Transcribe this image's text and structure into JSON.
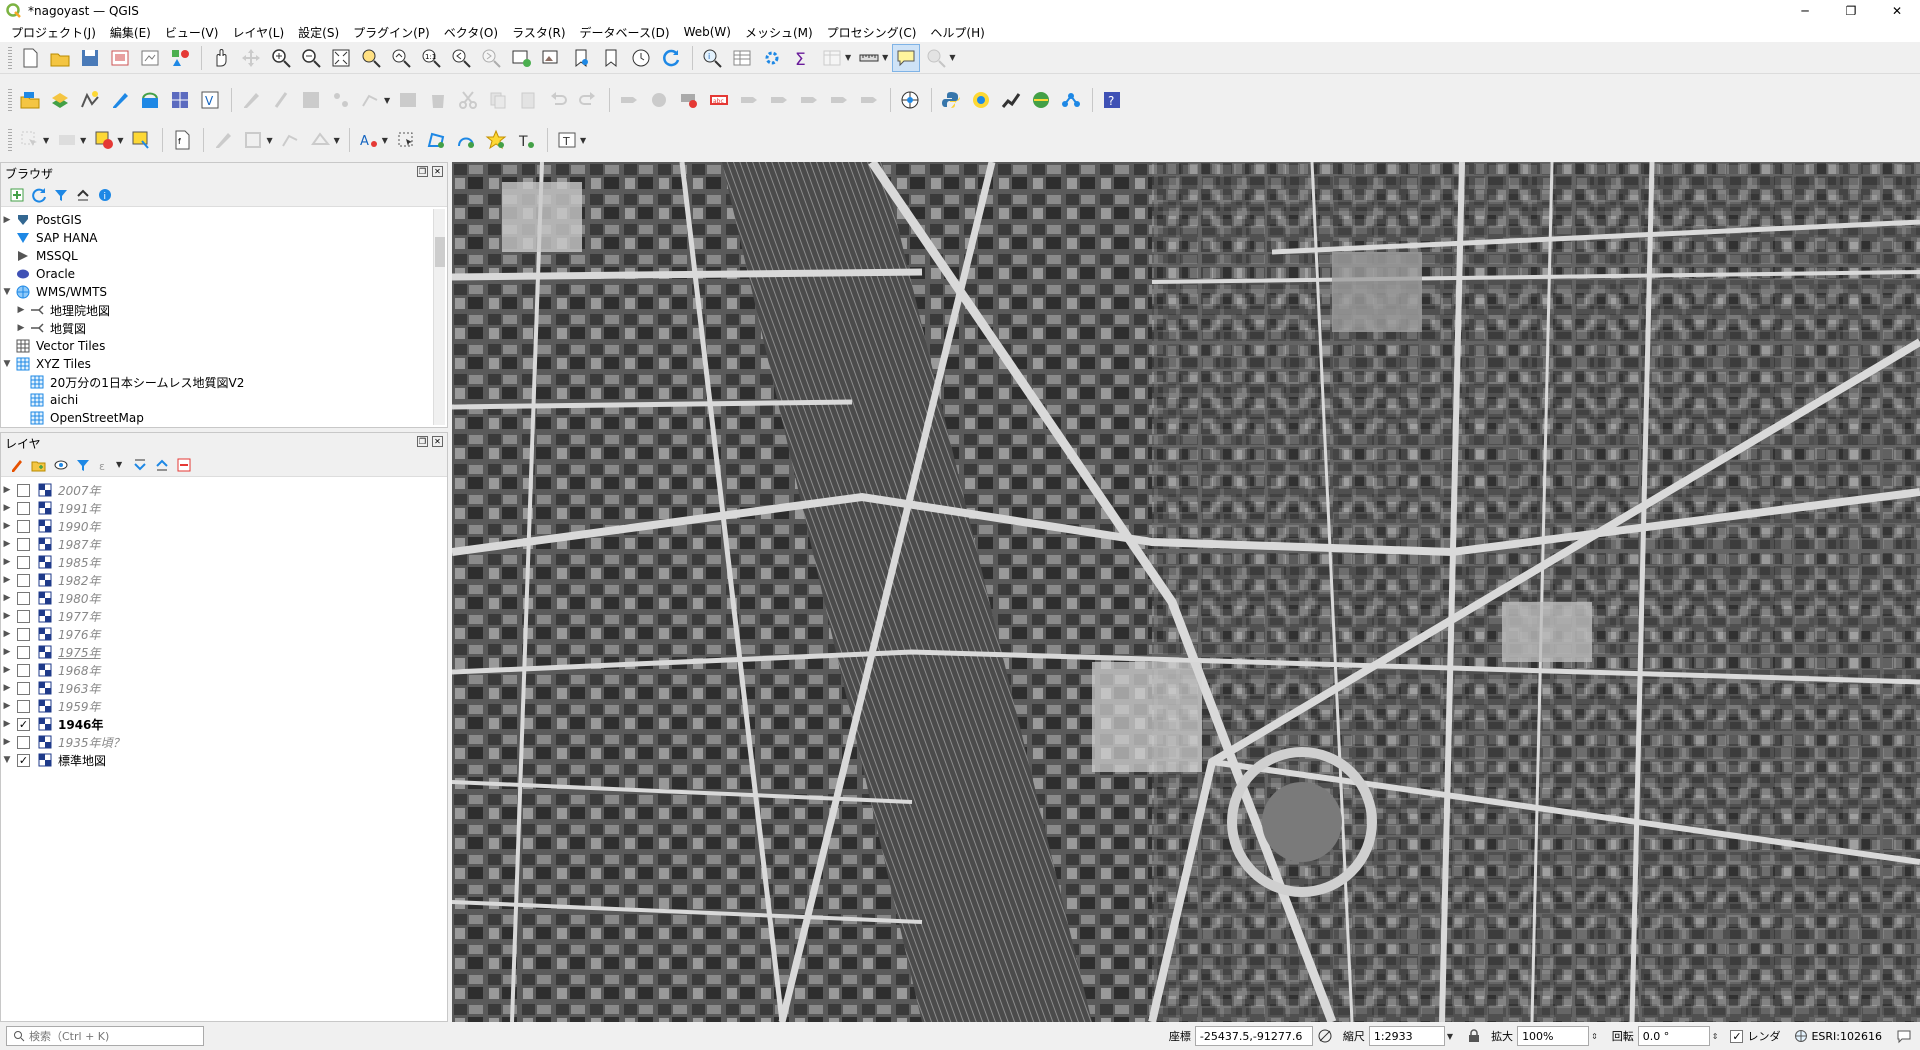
{
  "window": {
    "title": "*nagoyast — QGIS",
    "min": "─",
    "max": "❐",
    "close": "✕"
  },
  "menus": [
    "プロジェクト(J)",
    "編集(E)",
    "ビュー(V)",
    "レイヤ(L)",
    "設定(S)",
    "プラグイン(P)",
    "ベクタ(O)",
    "ラスタ(R)",
    "データベース(D)",
    "Web(W)",
    "メッシュ(M)",
    "プロセシング(C)",
    "ヘルプ(H)"
  ],
  "browser": {
    "title": "ブラウザ",
    "items": [
      {
        "label": "PostGIS",
        "icon": "postgis-icon"
      },
      {
        "label": "SAP HANA",
        "icon": "sap-hana-icon"
      },
      {
        "label": "MSSQL",
        "icon": "mssql-icon"
      },
      {
        "label": "Oracle",
        "icon": "oracle-icon"
      },
      {
        "label": "WMS/WMTS",
        "icon": "wms-globe-icon"
      },
      {
        "label": "地理院地図",
        "icon": "wms-layer-icon"
      },
      {
        "label": "地質図",
        "icon": "wms-layer-icon"
      },
      {
        "label": "Vector Tiles",
        "icon": "vector-tiles-icon"
      },
      {
        "label": "XYZ Tiles",
        "icon": "xyz-tiles-icon"
      },
      {
        "label": "20万分の1日本シームレス地質図V2",
        "icon": "xyz-tile-icon"
      },
      {
        "label": "aichi",
        "icon": "xyz-tile-icon"
      },
      {
        "label": "OpenStreetMap",
        "icon": "xyz-tile-icon"
      }
    ]
  },
  "layers": {
    "title": "レイヤ",
    "items": [
      {
        "label": "2007年",
        "checked": false
      },
      {
        "label": "1991年",
        "checked": false
      },
      {
        "label": "1990年",
        "checked": false
      },
      {
        "label": "1987年",
        "checked": false
      },
      {
        "label": "1985年",
        "checked": false
      },
      {
        "label": "1982年",
        "checked": false
      },
      {
        "label": "1980年",
        "checked": false
      },
      {
        "label": "1977年",
        "checked": false
      },
      {
        "label": "1976年",
        "checked": false
      },
      {
        "label": "1975年",
        "checked": false
      },
      {
        "label": "1968年",
        "checked": false
      },
      {
        "label": "1963年",
        "checked": false
      },
      {
        "label": "1959年",
        "checked": false
      },
      {
        "label": "1946年",
        "checked": true
      },
      {
        "label": "1935年頃？",
        "checked": false
      },
      {
        "label": "標準地図",
        "checked": true
      }
    ]
  },
  "statusbar": {
    "search_placeholder": "検索（Ctrl + K)",
    "coord_label": "座標",
    "coord_value": "-25437.5,-91277.6",
    "scale_label": "縮尺",
    "scale_value": "1:2933",
    "magnify_label": "拡大",
    "magnify_value": "100%",
    "rotation_label": "回転",
    "rotation_value": "0.0 °",
    "render_label": "レンダ",
    "crs_value": "ESRI:102616",
    "check_mark": "✓"
  }
}
